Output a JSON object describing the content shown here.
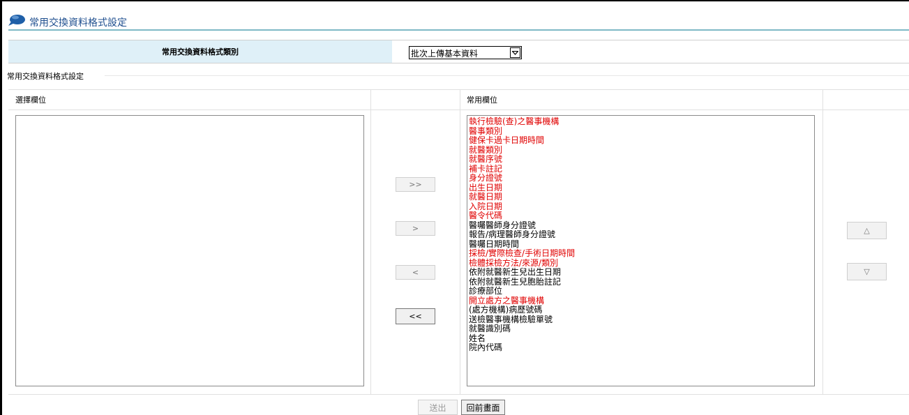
{
  "page": {
    "title": "常用交換資料格式設定"
  },
  "category": {
    "label": "常用交換資料格式類別",
    "selected": "批次上傳基本資料"
  },
  "fieldset": {
    "legend": "常用交換資料格式設定"
  },
  "columns": {
    "available_header": "選擇欄位",
    "selected_header": "常用欄位"
  },
  "move_buttons": {
    "add_all": ">>",
    "add": ">",
    "remove": "<",
    "remove_all": "<<"
  },
  "order_buttons": {
    "up": "△",
    "down": "▽"
  },
  "available_fields": [],
  "selected_fields": [
    {
      "label": "執行檢驗(查)之醫事機構",
      "required": true
    },
    {
      "label": "醫事類別",
      "required": true
    },
    {
      "label": "健保卡過卡日期時間",
      "required": true
    },
    {
      "label": "就醫類別",
      "required": true
    },
    {
      "label": "就醫序號",
      "required": true
    },
    {
      "label": "補卡註記",
      "required": true
    },
    {
      "label": "身分證號",
      "required": true
    },
    {
      "label": "出生日期",
      "required": true
    },
    {
      "label": "就醫日期",
      "required": true
    },
    {
      "label": "入院日期",
      "required": true
    },
    {
      "label": "醫令代碼",
      "required": true
    },
    {
      "label": "醫囑醫師身分證號",
      "required": false
    },
    {
      "label": "報告/病理醫師身分證號",
      "required": false
    },
    {
      "label": "醫囑日期時間",
      "required": false
    },
    {
      "label": "採檢/實際檢查/手術日期時間",
      "required": true
    },
    {
      "label": "檢體採檢方法/來源/類別",
      "required": true
    },
    {
      "label": "依附就醫新生兒出生日期",
      "required": false
    },
    {
      "label": "依附就醫新生兒胞胎註記",
      "required": false
    },
    {
      "label": "診療部位",
      "required": false
    },
    {
      "label": "開立處方之醫事機構",
      "required": true
    },
    {
      "label": "(處方機構)病歷號碼",
      "required": false
    },
    {
      "label": "送檢醫事機構檢驗單號",
      "required": false
    },
    {
      "label": "就醫識別碼",
      "required": false
    },
    {
      "label": "姓名",
      "required": false
    },
    {
      "label": "院內代碼",
      "required": false
    }
  ],
  "actions": {
    "submit": "送出",
    "back": "回前畫面"
  },
  "colors": {
    "required_text": "#e00000",
    "header_bg": "#dff0f8",
    "title_text": "#1f4f8f",
    "title_underline": "#7fb9c6",
    "bubble_icon": "#1f5fa8"
  }
}
